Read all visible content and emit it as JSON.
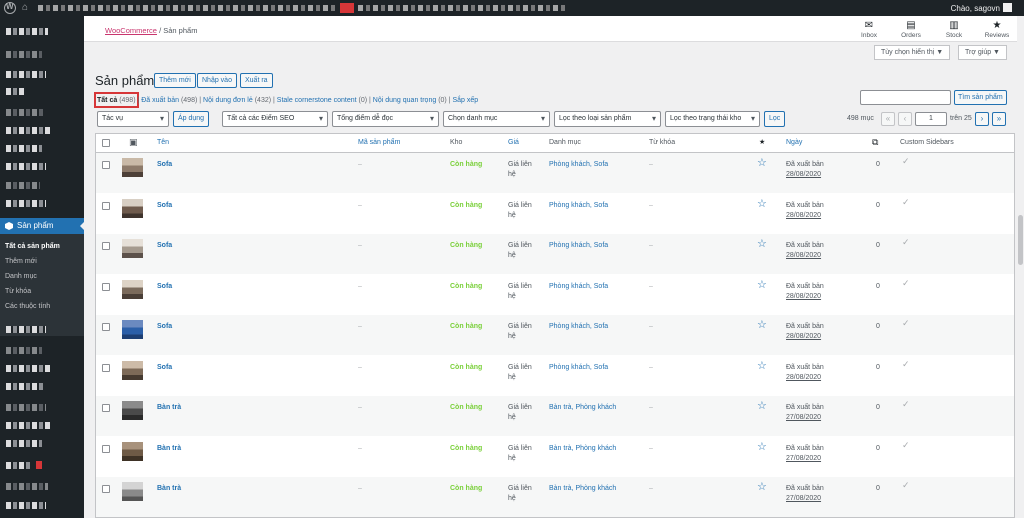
{
  "admin_bar": {
    "greeting": "Chào, sagovn"
  },
  "sidebar": {
    "active_menu": "Sản phẩm",
    "submenu": [
      "Tất cả sản phẩm",
      "Thêm mới",
      "Danh mục",
      "Từ khóa",
      "Các thuộc tính"
    ]
  },
  "breadcrumb": {
    "root": "WooCommerce",
    "separator": "/",
    "current": "Sản phẩm"
  },
  "activity": [
    {
      "label": "Inbox",
      "icon": "inbox-icon",
      "glyph": "✉"
    },
    {
      "label": "Orders",
      "icon": "orders-icon",
      "glyph": "▤"
    },
    {
      "label": "Stock",
      "icon": "stock-icon",
      "glyph": "▥"
    },
    {
      "label": "Reviews",
      "icon": "star-icon",
      "glyph": "★"
    }
  ],
  "screen_options": "Tùy chọn hiển thị ▼",
  "help": "Trợ giúp ▼",
  "page": {
    "title": "Sản phẩm",
    "buttons": {
      "add_new": "Thêm mới",
      "import": "Nhập vào",
      "export": "Xuất ra"
    }
  },
  "views": {
    "all": "Tất cả",
    "all_count": "(498)",
    "published": "Đã xuất bản",
    "published_count": "(498)",
    "orphan": "Nội dung đơn lẻ",
    "orphan_count": "(432)",
    "stale": "Stale cornerstone content",
    "stale_count": "(0)",
    "important": "Nội dung quan trọng",
    "important_count": "(0)",
    "sort": "Sắp xếp"
  },
  "search": {
    "value": "",
    "button": "Tìm sản phẩm"
  },
  "filters": {
    "bulk_action": "Tác vụ",
    "apply": "Áp dụng",
    "seo": "Tất cả các Điểm SEO",
    "readability": "Tổng điểm dễ đọc",
    "category": "Chọn danh mục",
    "product_type": "Lọc theo loại sản phẩm",
    "stock_status": "Lọc theo trạng thái kho",
    "filter": "Lọc"
  },
  "pagination": {
    "count": "498 mục",
    "first": "«",
    "prev": "‹",
    "current": "1",
    "of": "trên 25",
    "next": "›",
    "last": "»"
  },
  "table": {
    "columns": {
      "name": "Tên",
      "sku": "Mã sản phẩm",
      "stock": "Kho",
      "price": "Giá",
      "categories": "Danh mục",
      "tags": "Từ khóa",
      "featured": "★",
      "date": "Ngày",
      "sidebars": "Custom Sidebars"
    },
    "rows": [
      {
        "name": "Sofa",
        "sku": "–",
        "stock": "Còn hàng",
        "price1": "Giá liên",
        "price2": "hệ",
        "categories": "Phòng khách, Sofa",
        "tags": "–",
        "status": "Đã xuất bản",
        "date": "28/08/2020",
        "links": "0"
      },
      {
        "name": "Sofa",
        "sku": "–",
        "stock": "Còn hàng",
        "price1": "Giá liên",
        "price2": "hệ",
        "categories": "Phòng khách, Sofa",
        "tags": "–",
        "status": "Đã xuất bản",
        "date": "28/08/2020",
        "links": "0"
      },
      {
        "name": "Sofa",
        "sku": "–",
        "stock": "Còn hàng",
        "price1": "Giá liên",
        "price2": "hệ",
        "categories": "Phòng khách, Sofa",
        "tags": "–",
        "status": "Đã xuất bản",
        "date": "28/08/2020",
        "links": "0"
      },
      {
        "name": "Sofa",
        "sku": "–",
        "stock": "Còn hàng",
        "price1": "Giá liên",
        "price2": "hệ",
        "categories": "Phòng khách, Sofa",
        "tags": "–",
        "status": "Đã xuất bản",
        "date": "28/08/2020",
        "links": "0"
      },
      {
        "name": "Sofa",
        "sku": "–",
        "stock": "Còn hàng",
        "price1": "Giá liên",
        "price2": "hệ",
        "categories": "Phòng khách, Sofa",
        "tags": "–",
        "status": "Đã xuất bản",
        "date": "28/08/2020",
        "links": "0"
      },
      {
        "name": "Sofa",
        "sku": "–",
        "stock": "Còn hàng",
        "price1": "Giá liên",
        "price2": "hệ",
        "categories": "Phòng khách, Sofa",
        "tags": "–",
        "status": "Đã xuất bản",
        "date": "28/08/2020",
        "links": "0"
      },
      {
        "name": "Bàn trà",
        "sku": "–",
        "stock": "Còn hàng",
        "price1": "Giá liên",
        "price2": "hệ",
        "categories": "Bàn trà, Phòng khách",
        "tags": "–",
        "status": "Đã xuất bản",
        "date": "27/08/2020",
        "links": "0"
      },
      {
        "name": "Bàn trà",
        "sku": "–",
        "stock": "Còn hàng",
        "price1": "Giá liên",
        "price2": "hệ",
        "categories": "Bàn trà, Phòng khách",
        "tags": "–",
        "status": "Đã xuất bản",
        "date": "27/08/2020",
        "links": "0"
      },
      {
        "name": "Bàn trà",
        "sku": "–",
        "stock": "Còn hàng",
        "price1": "Giá liên",
        "price2": "hệ",
        "categories": "Bàn trà, Phòng khách",
        "tags": "–",
        "status": "Đã xuất bản",
        "date": "27/08/2020",
        "links": "0"
      }
    ]
  },
  "colors": {
    "accent": "#2271b1",
    "in_stock": "#7ad03a",
    "highlight": "#d63638",
    "menu_bg": "#1d2327"
  }
}
